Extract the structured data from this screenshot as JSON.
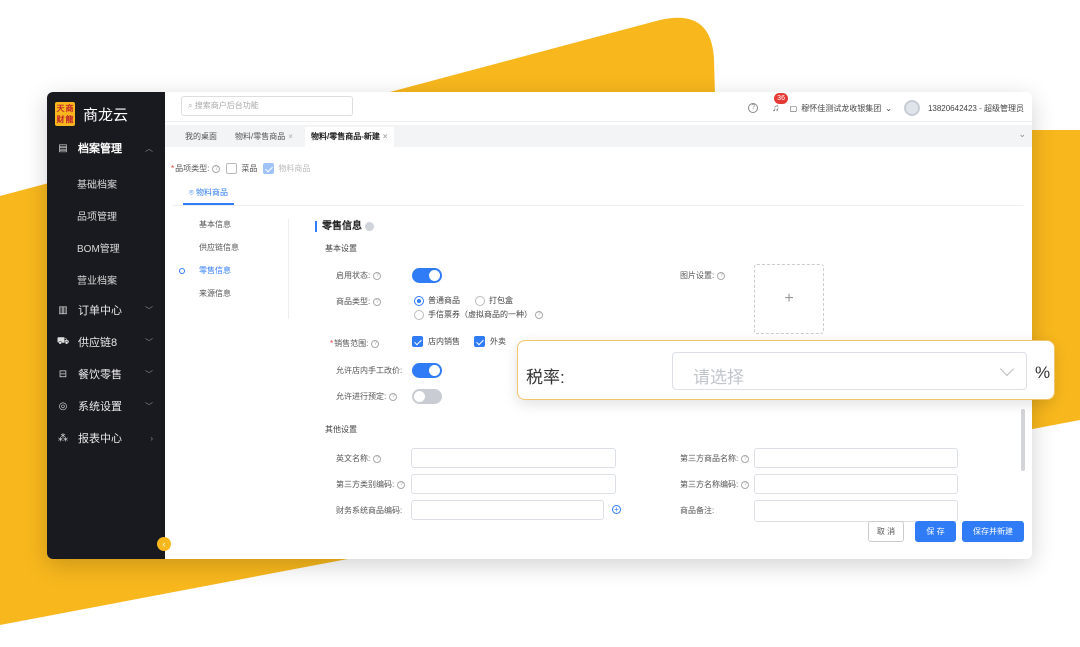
{
  "colors": {
    "accent": "#2f7cf6",
    "brand_yellow": "#f7b71d",
    "sidebar_bg": "#191a1f",
    "required": "#e53935"
  },
  "sidebar": {
    "logo_badge": [
      "天",
      "商",
      "财",
      "龍"
    ],
    "logo_text": "商龙云",
    "groups": [
      {
        "label": "档案管理",
        "icon": "archive-icon",
        "active": true
      },
      {
        "label": "订单中心",
        "icon": "order-icon"
      },
      {
        "label": "供应链8",
        "icon": "truck-icon"
      },
      {
        "label": "餐饮零售",
        "icon": "cart-icon"
      },
      {
        "label": "系统设置",
        "icon": "settings-icon"
      },
      {
        "label": "报表中心",
        "icon": "report-icon"
      }
    ],
    "subitems": [
      "基础档案",
      "品项管理",
      "BOM管理",
      "营业档案"
    ],
    "collapse": "‹"
  },
  "topbar": {
    "search_placeholder": "搜索商户后台功能",
    "notification_count": "36",
    "org": "穆怀佳测试龙收银集团",
    "user": "13820642423 - 超级管理员"
  },
  "tabs": [
    {
      "label": "我的桌面",
      "closable": false
    },
    {
      "label": "物料/零售商品",
      "closable": true
    },
    {
      "label": "物料/零售商品-新建",
      "closable": true,
      "active": true
    }
  ],
  "form": {
    "category_label": "品项类型:",
    "category_options": [
      "菜品",
      "物料商品"
    ],
    "subtab": "物料商品",
    "anchors": [
      "基本信息",
      "供应链信息",
      "零售信息",
      "来源信息"
    ],
    "section_title": "零售信息",
    "basic_settings": "基本设置",
    "enable_label": "启用状态:",
    "image_label": "图片设置:",
    "goods_type_label": "商品类型:",
    "goods_type_options": [
      "普通商品",
      "打包盒",
      "手信票券（虚拟商品的一种）"
    ],
    "sales_scope_label": "销售范围:",
    "sales_scope_options": [
      "店内销售",
      "外卖"
    ],
    "manual_price_label": "允许店内手工改价:",
    "preorder_label": "允许进行预定:",
    "other_settings": "其他设置",
    "english_name_label": "英文名称:",
    "third_goods_name_label": "第三方商品名称:",
    "third_category_code_label": "第三方类别编码:",
    "third_name_code_label": "第三方名称编码:",
    "finance_code_label": "财务系统商品编码:",
    "remark_label": "商品备注:",
    "upload_plus": "+"
  },
  "actions": {
    "cancel": "取 消",
    "save": "保 存",
    "save_new": "保存并新建"
  },
  "callout": {
    "label": "税率:",
    "placeholder": "请选择",
    "unit": "%"
  }
}
